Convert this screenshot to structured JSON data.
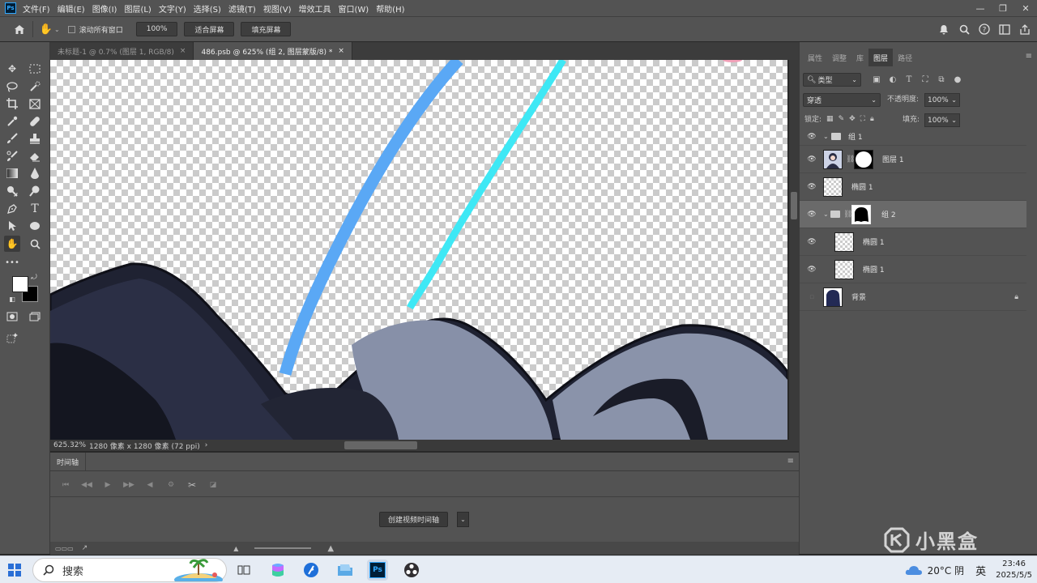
{
  "app": {
    "logo": "Ps"
  },
  "menu": [
    "文件(F)",
    "编辑(E)",
    "图像(I)",
    "图层(L)",
    "文字(Y)",
    "选择(S)",
    "滤镜(T)",
    "视图(V)",
    "增效工具",
    "窗口(W)",
    "帮助(H)"
  ],
  "window_controls": {
    "minimize": "—",
    "restore": "❐",
    "close": "✕"
  },
  "options_bar": {
    "scroll_all_label": "滚动所有窗口",
    "zoom_value": "100%",
    "fit_screen": "适合屏幕",
    "fill_screen": "填充屏幕"
  },
  "doc_tabs": [
    {
      "label": "未标题-1 @ 0.7% (图层 1, RGB/8)",
      "close": "×"
    },
    {
      "label": "486.psb @ 625% (组 2, 图层蒙版/8) *",
      "close": "×"
    }
  ],
  "status": {
    "zoom": "625.32%",
    "doc_info": "1280 像素 x 1280 像素 (72 ppi)",
    "arrow": "›"
  },
  "timeline": {
    "tab": "时间轴",
    "create_button": "创建视频时间轴"
  },
  "panel": {
    "tabs": [
      "属性",
      "调整",
      "库",
      "图层",
      "路径"
    ],
    "active_tab": "图层",
    "filter": "类型",
    "blend_mode": "穿透",
    "opacity_label": "不透明度:",
    "opacity": "100%",
    "lock_label": "锁定:",
    "fill_label": "填充:",
    "fill": "100%"
  },
  "layers": [
    {
      "name": "组 1",
      "type": "group",
      "selected": false
    },
    {
      "name": "图层 1",
      "type": "image-masked",
      "selected": false
    },
    {
      "name": "椭圆 1",
      "type": "shape",
      "selected": false
    },
    {
      "name": "组 2",
      "type": "group-masked",
      "selected": true
    },
    {
      "name": "椭圆 1",
      "type": "shape",
      "selected": false
    },
    {
      "name": "椭圆 1",
      "type": "shape",
      "selected": false
    },
    {
      "name": "背景",
      "type": "background",
      "locked": true,
      "selected": false
    }
  ],
  "taskbar": {
    "search": "搜索",
    "weather": "20°C 阴",
    "ime": "英",
    "time": "23:46",
    "date": "2025/5/5"
  },
  "watermark": "小黑盒",
  "colors": {
    "accent": "#31a8ff",
    "stroke_blue": "#5aa8f5",
    "stroke_cyan": "#3ee8f5",
    "hair_dark": "#2b2f45",
    "hair_light": "#8790a8"
  }
}
